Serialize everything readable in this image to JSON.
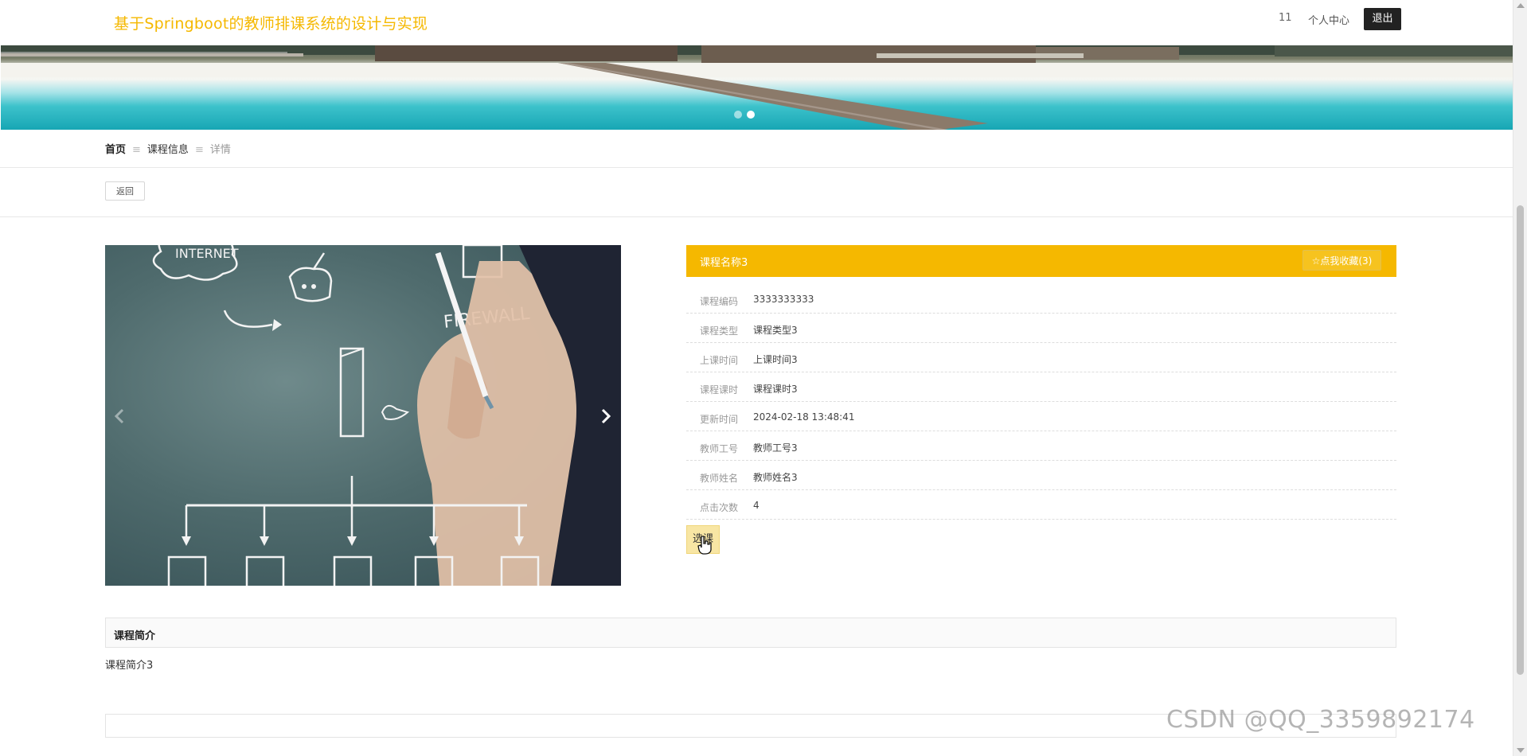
{
  "header": {
    "site_title": "基于Springboot的教师排课系统的设计与实现",
    "user_name": "11",
    "user_center_label": "个人中心",
    "logout_label": "退出"
  },
  "breadcrumb": {
    "home": "首页",
    "list": "课程信息",
    "current": "详情",
    "separator": "≡"
  },
  "back_label": "返回",
  "detail": {
    "course_name": "课程名称3",
    "favorite_label": "☆点我收藏(3)",
    "fields": [
      {
        "label": "课程编码",
        "value": "3333333333"
      },
      {
        "label": "课程类型",
        "value": "课程类型3"
      },
      {
        "label": "上课时间",
        "value": "上课时间3"
      },
      {
        "label": "课程课时",
        "value": "课程课时3"
      },
      {
        "label": "更新时间",
        "value": "2024-02-18 13:48:41"
      },
      {
        "label": "教师工号",
        "value": "教师工号3"
      },
      {
        "label": "教师姓名",
        "value": "教师姓名3"
      },
      {
        "label": "点击次数",
        "value": "4"
      }
    ],
    "select_label": "选课"
  },
  "carousel": {
    "image_texts": [
      "INTERNET",
      "FIREWALL"
    ],
    "prev_icon": "chevron-left-icon",
    "next_icon": "chevron-right-icon"
  },
  "intro": {
    "title": "课程简介",
    "text": "课程简介3"
  },
  "watermark": "CSDN @QQ_3359892174",
  "colors": {
    "accent": "#f5b800",
    "header_dark_button": "#222222",
    "select_button": "#f8e6a4"
  }
}
